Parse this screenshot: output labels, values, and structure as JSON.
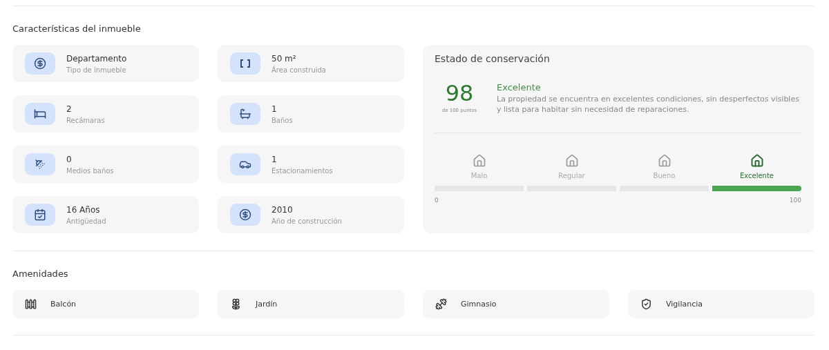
{
  "features": {
    "title": "Características del inmueble",
    "items": [
      {
        "value": "Departamento",
        "label": "Tipo de inmueble"
      },
      {
        "value": "50 m²",
        "label": "Área construida"
      },
      {
        "value": "2",
        "label": "Recámaras"
      },
      {
        "value": "1",
        "label": "Baños"
      },
      {
        "value": "0",
        "label": "Medios baños"
      },
      {
        "value": "1",
        "label": "Estacionamientos"
      },
      {
        "value": "16 Años",
        "label": "Antigüedad"
      },
      {
        "value": "2010",
        "label": "Año de construcción"
      }
    ]
  },
  "condition": {
    "title": "Estado de conservación",
    "score": "98",
    "score_caption": "de 100 puntos",
    "rating": "Excelente",
    "description": "La propiedad se encuentra en excelentes condiciones, sin desperfectos visibles y lista para habitar sin necesidad de reparaciones.",
    "levels": [
      {
        "label": "Malo",
        "selected": false
      },
      {
        "label": "Regular",
        "selected": false
      },
      {
        "label": "Bueno",
        "selected": false
      },
      {
        "label": "Excelente",
        "selected": true
      }
    ],
    "scale_min": "0",
    "scale_max": "100"
  },
  "amenities": {
    "title": "Amenidades",
    "items": [
      {
        "label": "Balcón"
      },
      {
        "label": "Jardín"
      },
      {
        "label": "Gimnasio"
      },
      {
        "label": "Vigilancia"
      }
    ]
  }
}
